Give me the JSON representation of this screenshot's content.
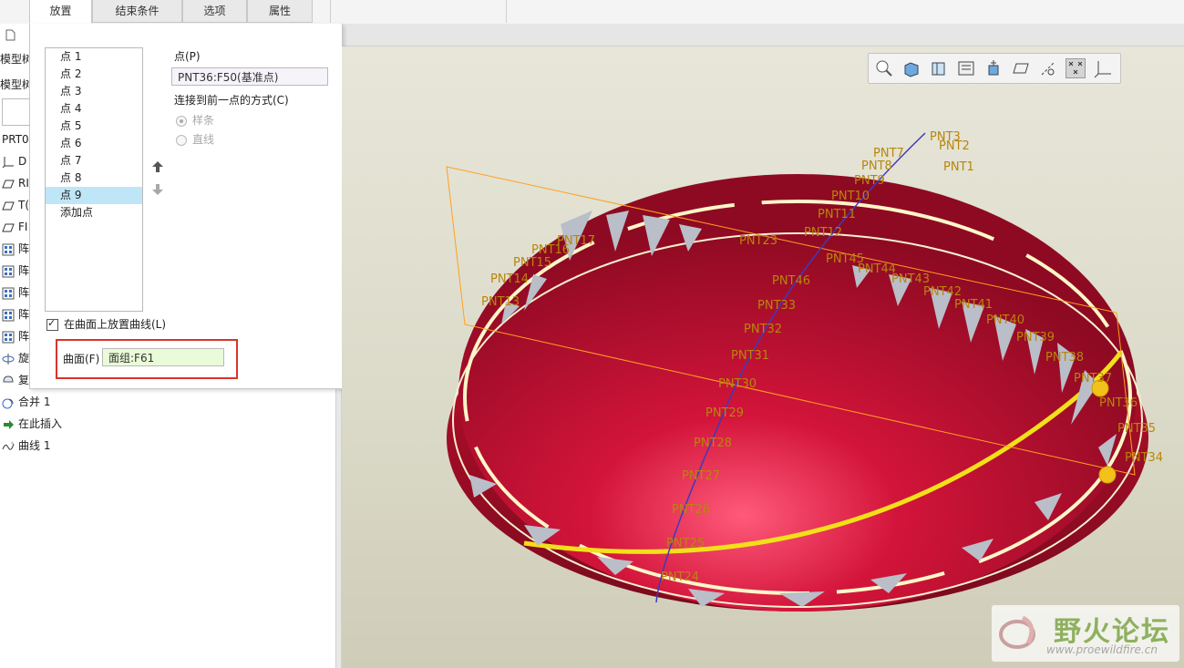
{
  "tabs": [
    "放置",
    "结束条件",
    "选项",
    "属性"
  ],
  "tree": {
    "header1": "模型树",
    "header2": "模型树",
    "part_name": "PRT0",
    "items": [
      {
        "label": "D",
        "icon": "csys-icon"
      },
      {
        "label": "RI",
        "icon": "plane-icon"
      },
      {
        "label": "T(",
        "icon": "plane-icon"
      },
      {
        "label": "FI",
        "icon": "plane-icon"
      },
      {
        "label": "阵",
        "icon": "pattern-icon"
      },
      {
        "label": "阵",
        "icon": "pattern-icon"
      },
      {
        "label": "阵",
        "icon": "pattern-icon"
      },
      {
        "label": "阵",
        "icon": "pattern-icon"
      },
      {
        "label": "阵",
        "icon": "pattern-icon"
      },
      {
        "label": "旋",
        "icon": "revolve-icon"
      },
      {
        "label": "复",
        "icon": "copy-icon"
      },
      {
        "label": "合并 1",
        "icon": "merge-icon"
      },
      {
        "label": "在此插入",
        "icon": "insert-here-icon"
      },
      {
        "label": "曲线 1",
        "icon": "curve-icon"
      }
    ]
  },
  "panel": {
    "points": [
      "点 1",
      "点 2",
      "点 3",
      "点 4",
      "点 5",
      "点 6",
      "点 7",
      "点 8",
      "点 9",
      "添加点"
    ],
    "selected_index": 8,
    "point_label": "点(P)",
    "point_value": "PNT36:F50(基准点)",
    "connect_label": "连接到前一点的方式(C)",
    "radio_spline": "样条",
    "radio_line": "直线",
    "place_on_surface": "在曲面上放置曲线(L)",
    "surface_label": "曲面(F)",
    "surface_value": "面组:F61"
  },
  "viewport": {
    "labels": [
      "PNT3",
      "PNT2",
      "PNT1",
      "PNT7",
      "PNT8",
      "PNT9",
      "PNT10",
      "PNT11",
      "PNT12",
      "PNT46",
      "PNT33",
      "PNT32",
      "PNT31",
      "PNT30",
      "PNT29",
      "PNT28",
      "PNT27",
      "PNT26",
      "PNT25",
      "PNT24",
      "PNT13",
      "PNT14",
      "PNT15",
      "PNT16",
      "PNT17",
      "PNT23",
      "PNT45",
      "PNT44",
      "PNT43",
      "PNT42",
      "PNT41",
      "PNT40",
      "PNT39",
      "PNT38",
      "PNT37",
      "PNT36",
      "PNT35",
      "PNT34"
    ],
    "toolbar": [
      "zoom-icon",
      "shaded-view-icon",
      "saved-views-icon",
      "display-style-icon",
      "spin-center-icon",
      "datum-plane-display-icon",
      "datum-axis-display-icon",
      "datum-point-display-icon",
      "csys-display-icon"
    ]
  },
  "watermark": {
    "title": "野火论坛",
    "url": "www.proewildfire.cn"
  },
  "colors": {
    "part": "#c8102e",
    "label": "#b8860b",
    "highlight_box": "#d9342b",
    "selection": "#bfe6f7"
  }
}
